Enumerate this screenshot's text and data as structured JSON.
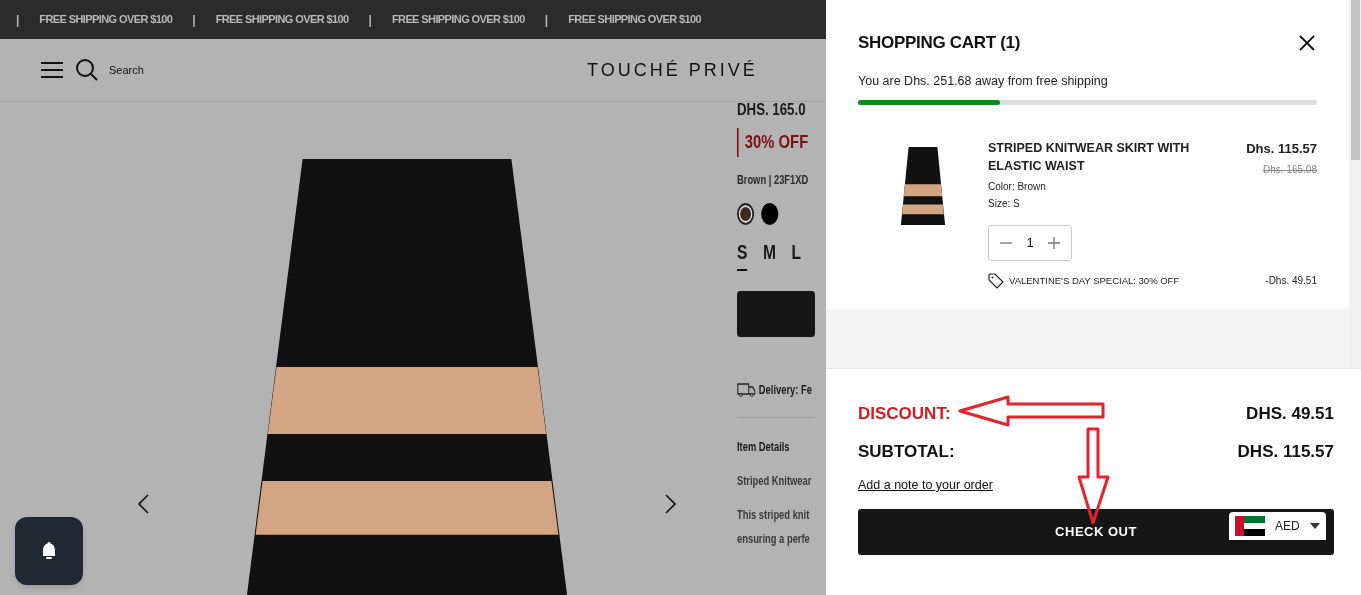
{
  "announcement": {
    "items": [
      {
        "separator": "|",
        "text": "FREE SHIPPING OVER $100"
      },
      {
        "separator": "|",
        "text": "FREE SHIPPING OVER $100"
      },
      {
        "separator": "|",
        "text": "FREE SHIPPING OVER $100"
      },
      {
        "separator": "|",
        "text": "FREE SHIPPING OVER $100"
      }
    ]
  },
  "header": {
    "search_label": "Search",
    "logo": "TOUCHÉ PRIVÉ"
  },
  "product": {
    "price": "DHS. 165.0",
    "discount": "30% OFF",
    "variant": "Brown | 23F1XD",
    "swatches": [
      {
        "color": "#3b2a1e",
        "selected": true
      },
      {
        "color": "#000000",
        "selected": false
      }
    ],
    "sizes": [
      {
        "label": "S",
        "selected": true
      },
      {
        "label": "M",
        "selected": false
      },
      {
        "label": "L",
        "selected": false
      }
    ],
    "delivery": "Delivery: Fe",
    "details_title": "Item Details",
    "details_subtitle": "Striped Knitwear",
    "description": [
      "This striped knit",
      "ensuring a perfe"
    ]
  },
  "cart": {
    "title": "SHOPPING CART (1)",
    "shipping_message": "You are Dhs. 251.68 away from free shipping",
    "shipping_progress": {
      "level": 0.31
    },
    "item": {
      "name": "STRIPED KNITWEAR SKIRT WITH ELASTIC WAIST",
      "color_text": "Color: Brown",
      "size": "Size: S",
      "price": "Dhs. 115.57",
      "compare_price": "Dhs. 165.08",
      "quantity": "1",
      "discount_label": "VALENTINE'S DAY SPECIAL: 30% OFF",
      "discount_amount": "-Dhs. 49.51"
    },
    "summary": {
      "discount_label": "DISCOUNT:",
      "discount_value": "DHS. 49.51",
      "subtotal_label": "SUBTOTAL:",
      "subtotal_value": "DHS. 115.57",
      "note_link": "Add a note to your order",
      "checkout": "CHECK OUT"
    }
  },
  "currency": {
    "code": "AED"
  }
}
